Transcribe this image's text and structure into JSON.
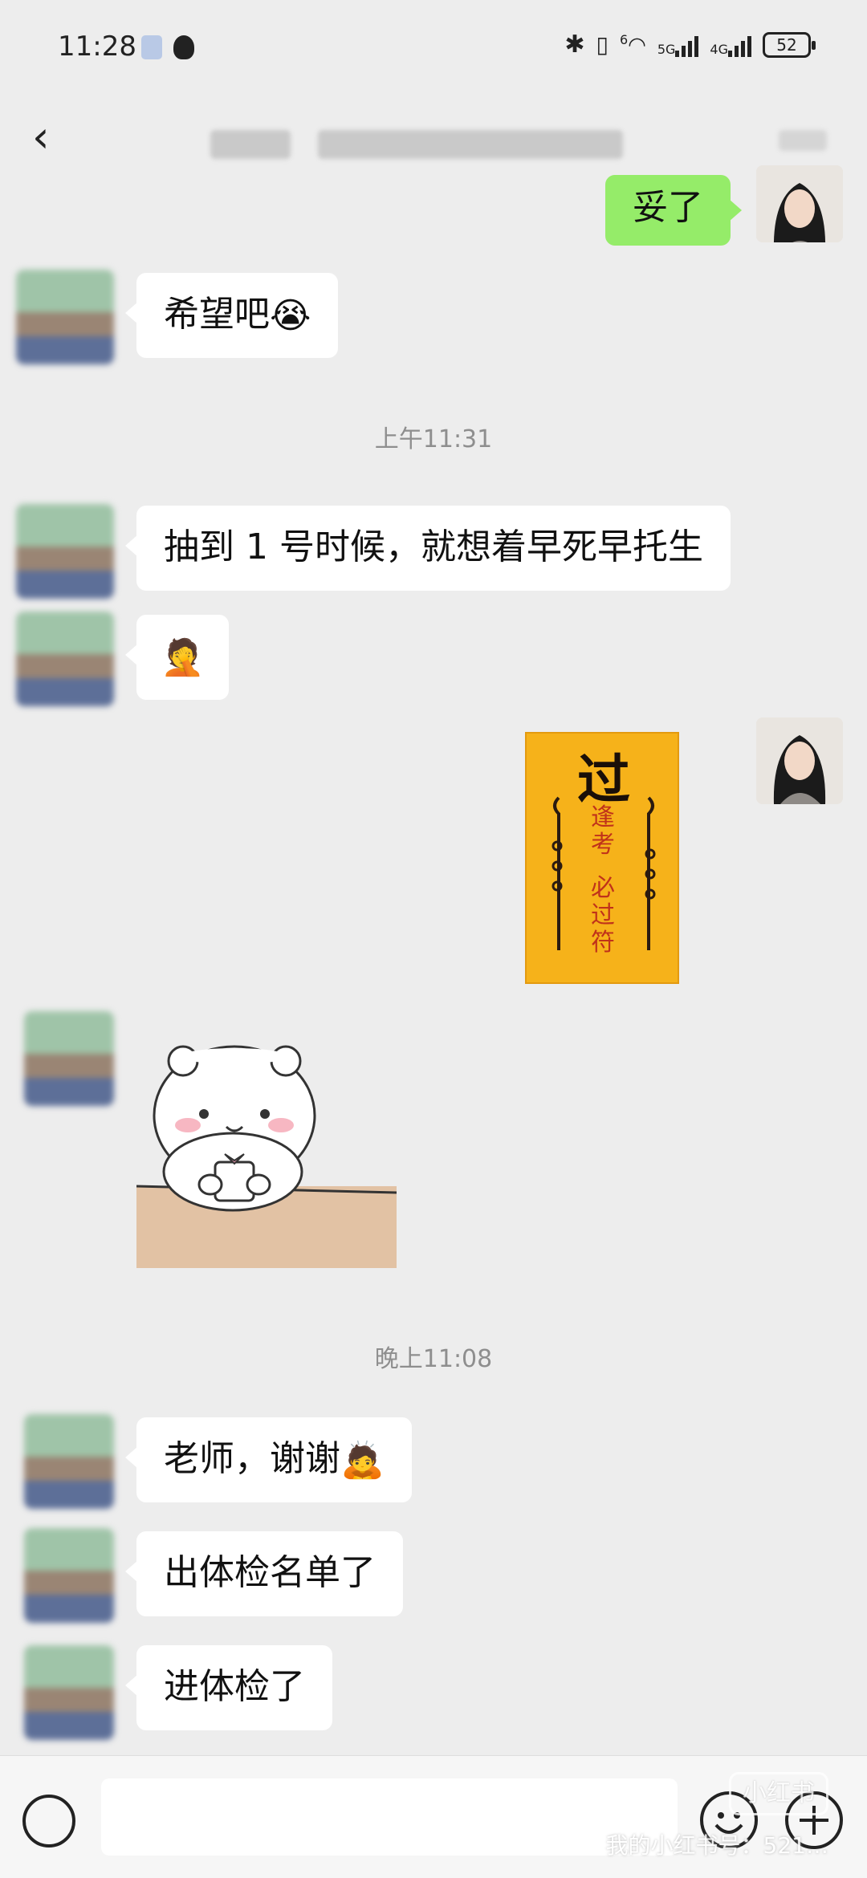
{
  "status_bar": {
    "time": "11:28",
    "network_5g": "5G",
    "network_4g": "4G",
    "wifi_badge": "6",
    "battery": "52"
  },
  "nav": {
    "back_icon": "chevron-left-icon",
    "title": ""
  },
  "messages": [
    {
      "id": "m1",
      "side": "right",
      "type": "text",
      "text": "妥了"
    },
    {
      "id": "m2",
      "side": "left",
      "type": "text",
      "text": "希望吧",
      "emoji": "😭"
    },
    {
      "id": "t1",
      "type": "timestamp",
      "text": "上午11:31"
    },
    {
      "id": "m3",
      "side": "left",
      "type": "text",
      "text": "抽到 1 号时候，就想着早死早托生"
    },
    {
      "id": "m4",
      "side": "left",
      "type": "emoji",
      "emoji": "🤦"
    },
    {
      "id": "m5",
      "side": "right",
      "type": "sticker",
      "sticker": {
        "big_char": "过",
        "line1": "逢考",
        "line2": "必过符"
      }
    },
    {
      "id": "m6",
      "side": "left",
      "type": "sticker",
      "sticker": "bear-with-cup"
    },
    {
      "id": "t2",
      "type": "timestamp",
      "text": "晚上11:08"
    },
    {
      "id": "m7",
      "side": "left",
      "type": "text",
      "text": "老师，谢谢",
      "emoji": "🙇"
    },
    {
      "id": "m8",
      "side": "left",
      "type": "text",
      "text": "出体检名单了"
    },
    {
      "id": "m9",
      "side": "left",
      "type": "text",
      "text": "进体检了"
    }
  ],
  "input_bar": {
    "placeholder": "",
    "voice_icon": "voice-icon",
    "emoji_icon": "emoji-icon",
    "plus_icon": "plus-icon"
  },
  "watermark": {
    "logo": "小红书",
    "text": "我的小红书号：521…"
  },
  "colors": {
    "background": "#ededed",
    "bubble_self": "#95ec69",
    "bubble_other": "#ffffff",
    "timestamp": "#8e8e8e",
    "talisman_bg": "#f6b21a",
    "talisman_text": "#c0321a"
  }
}
